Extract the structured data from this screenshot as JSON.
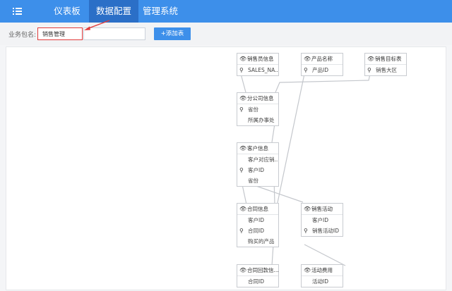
{
  "nav": {
    "menu_icon": "list-icon",
    "tabs": [
      {
        "label": "仪表板",
        "active": false
      },
      {
        "label": "数据配置",
        "active": true
      },
      {
        "label": "管理系统",
        "active": false
      }
    ]
  },
  "toolbar": {
    "package_label": "业务包名:",
    "package_value": "销售管理",
    "table_search_value": "",
    "add_table_label": "+添加表"
  },
  "colors": {
    "nav_bg": "#3d8fea",
    "nav_active": "#2b6fc7",
    "button": "#3d8fea",
    "annotation_red": "#e03b3b"
  },
  "tables": [
    {
      "title": "销售员信息",
      "rows": [
        {
          "text": "SALES_NA...",
          "key": true
        }
      ]
    },
    {
      "title": "产品名称",
      "rows": [
        {
          "text": "产品ID",
          "key": true
        }
      ]
    },
    {
      "title": "销售目标表",
      "rows": [
        {
          "text": "销售大区",
          "key": true
        }
      ]
    },
    {
      "title": "分公司信息",
      "rows": [
        {
          "text": "省份",
          "key": true
        },
        {
          "text": "所属办事处",
          "key": false
        }
      ]
    },
    {
      "title": "客户信息",
      "rows": [
        {
          "text": "客户对应销...",
          "key": false
        },
        {
          "text": "客户ID",
          "key": true
        },
        {
          "text": "省份",
          "key": false
        }
      ]
    },
    {
      "title": "合同信息",
      "rows": [
        {
          "text": "客户ID",
          "key": false
        },
        {
          "text": "合同ID",
          "key": true
        },
        {
          "text": "购买的产品",
          "key": false
        }
      ]
    },
    {
      "title": "销售活动",
      "rows": [
        {
          "text": "客户ID",
          "key": false
        },
        {
          "text": "销售活动ID",
          "key": true
        }
      ]
    },
    {
      "title": "合同回款信...",
      "rows": [
        {
          "text": "合同ID",
          "key": false
        }
      ]
    },
    {
      "title": "活动费用",
      "rows": [
        {
          "text": "活动ID",
          "key": false
        }
      ]
    }
  ]
}
